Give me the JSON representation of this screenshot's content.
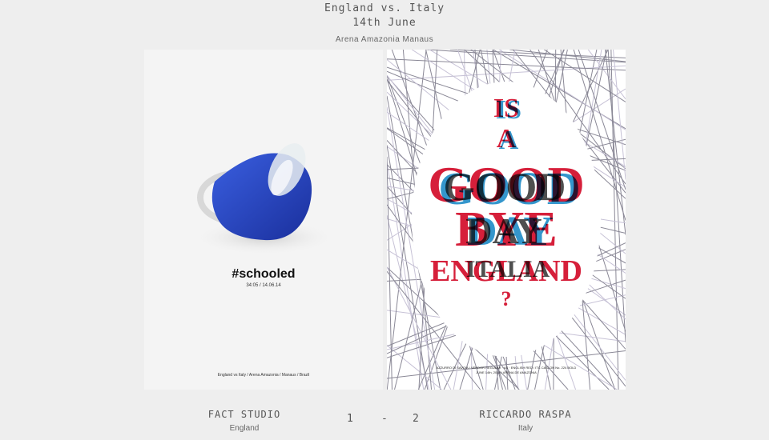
{
  "header": {
    "match": "England vs. Italy",
    "date": "14th June",
    "venue": "Arena Amazonia Manaus"
  },
  "left_poster": {
    "hashtag": "#schooled",
    "time": "34:05 / 14.06.14",
    "footer": "England vs Italy / Arena Amazonia / Manaus / Brazil"
  },
  "right_poster": {
    "line1_red": "IS",
    "line1_blue": "IS",
    "line2_red": "A",
    "line2_blue": "A",
    "line3_red": "GOOD",
    "line3_blue": "GOOD",
    "line3_dark": "GOOD",
    "line4_red": "BYE",
    "line4_blue": "DAY",
    "line4_dark": "DAY",
    "line5_red": "ENGLAND",
    "line5_dark": "ITALIA",
    "line6": "?",
    "credit_line1": "AZZURRO DI SAVOIA / VENDOR REGULAR · AS · ENGLISH RED / ITC CASLON No. 224 BOLD",
    "credit_line2": "JUNE 14th, 2014 / ARENA DE AMAZONIA"
  },
  "footer": {
    "left_name": "FACT STUDIO",
    "left_country": "England",
    "right_name": "RICCARDO RASPA",
    "right_country": "Italy",
    "score_left": "1",
    "score_sep": "-",
    "score_right": "2"
  }
}
